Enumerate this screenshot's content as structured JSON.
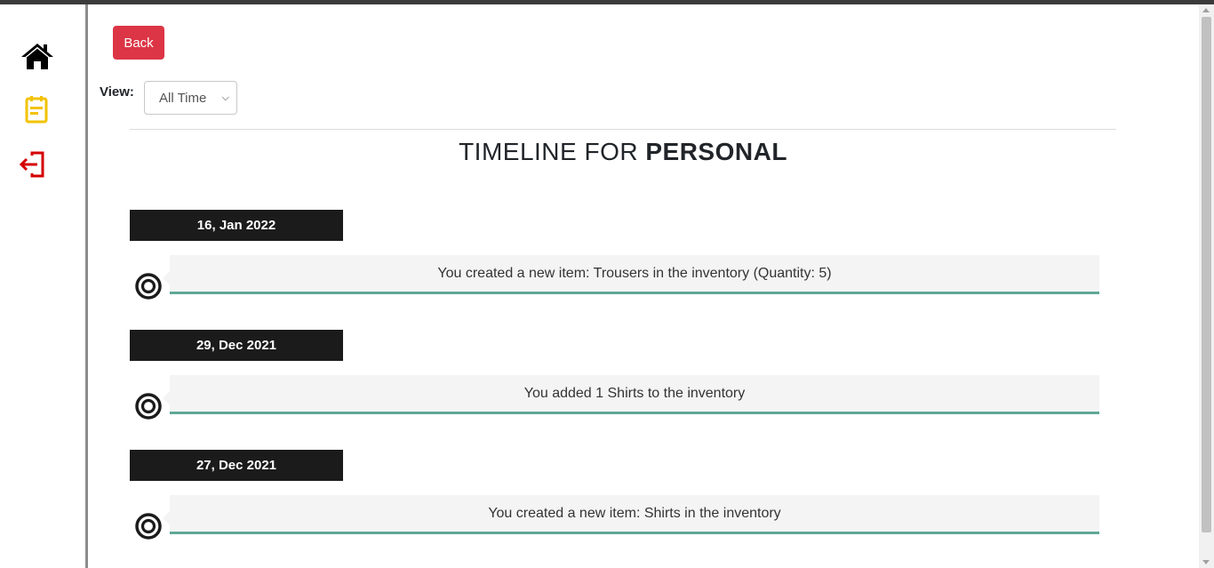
{
  "back_button": {
    "label": "Back"
  },
  "view_filter": {
    "label": "View:",
    "selected": "All Time"
  },
  "title": {
    "prefix": "TIMELINE FOR ",
    "emphasis": "PERSONAL"
  },
  "timeline": [
    {
      "date": "16, Jan 2022",
      "text": "You created a new item: Trousers in the inventory (Quantity: 5)"
    },
    {
      "date": "29, Dec 2021",
      "text": "You added 1 Shirts to the inventory"
    },
    {
      "date": "27, Dec 2021",
      "text": "You created a new item: Shirts in the inventory"
    }
  ],
  "sidebar": {
    "items": [
      {
        "icon": "home-icon",
        "color": "#000000"
      },
      {
        "icon": "notepad-icon",
        "color": "#f2c200"
      },
      {
        "icon": "logout-icon",
        "color": "#d40000"
      }
    ]
  },
  "colors": {
    "back_button": "#dc3545",
    "date_badge": "#1b1b1b",
    "card_underline": "#5fa796",
    "card_background": "#f4f4f4"
  }
}
